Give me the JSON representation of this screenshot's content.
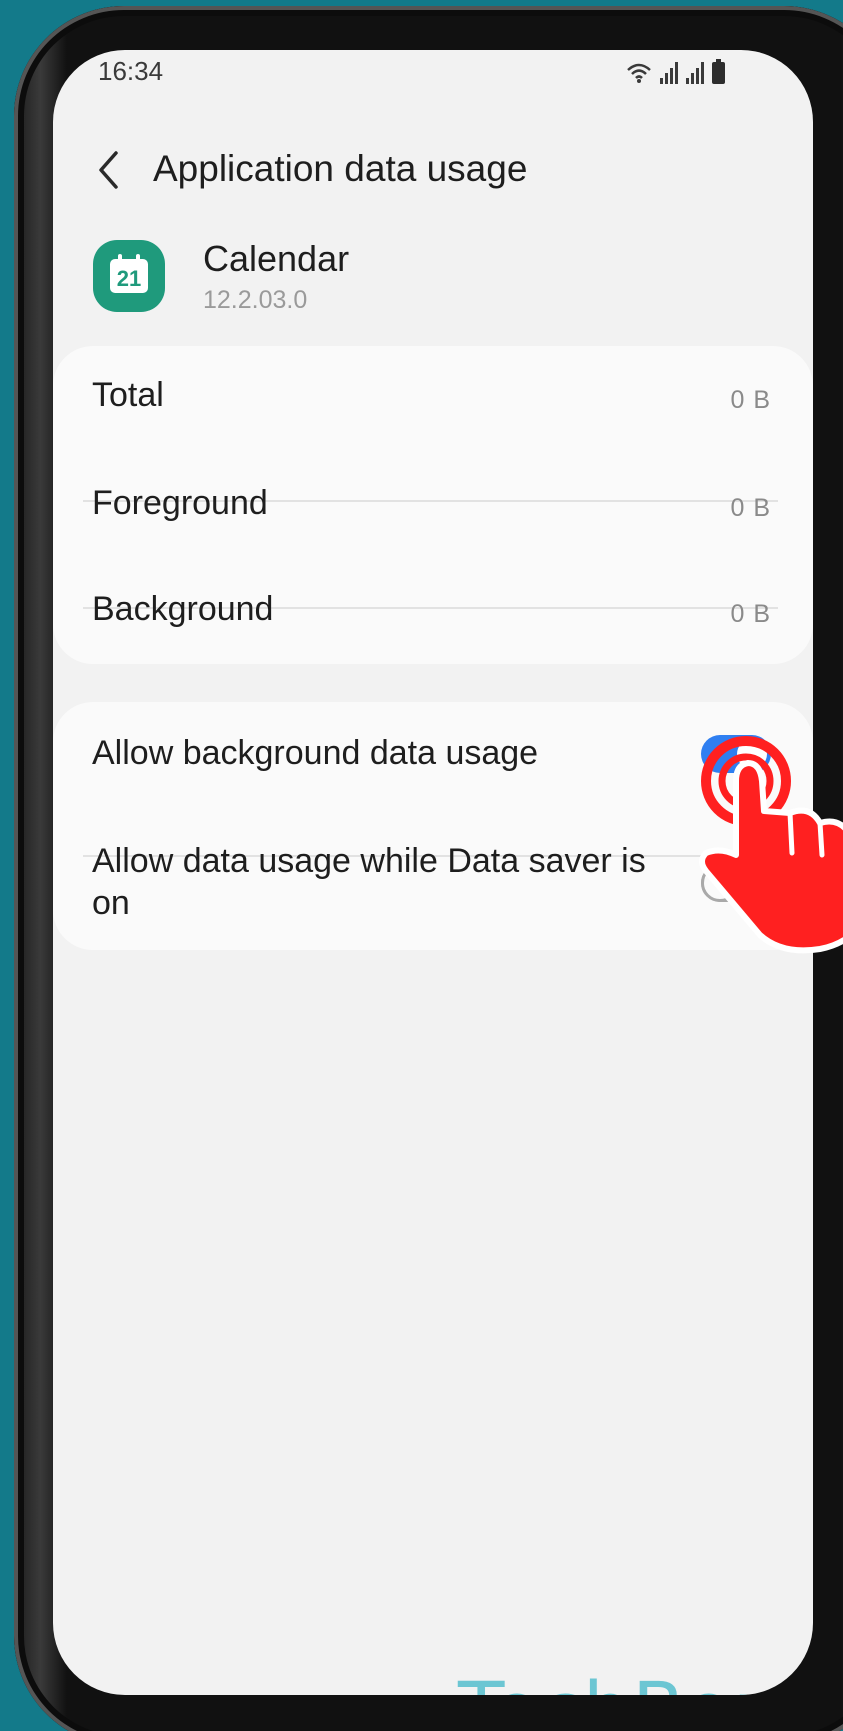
{
  "status_bar": {
    "time": "16:34",
    "icons": [
      "wifi-icon",
      "signal-icon",
      "signal-icon",
      "battery-icon"
    ]
  },
  "header": {
    "back_icon": "chevron-left-icon",
    "title": "Application data usage"
  },
  "app": {
    "icon": "calendar-icon",
    "icon_number": "21",
    "name": "Calendar",
    "version": "12.2.03.0"
  },
  "usage": {
    "rows": [
      {
        "label": "Total",
        "value": "0 B"
      },
      {
        "label": "Foreground",
        "value": "0 B"
      },
      {
        "label": "Background",
        "value": "0 B"
      }
    ]
  },
  "settings": {
    "toggles": [
      {
        "label": "Allow background data usage",
        "enabled": true
      },
      {
        "label": "Allow data usage while Data saver is on",
        "enabled": false
      }
    ]
  },
  "overlay": {
    "pointer_icon": "tap-hand-icon",
    "pointer_color": "#ff2020"
  },
  "watermark": "TechBone",
  "colors": {
    "background": "#137a8a",
    "accent": "#2f7ff1",
    "app_icon": "#1f9a7c"
  }
}
